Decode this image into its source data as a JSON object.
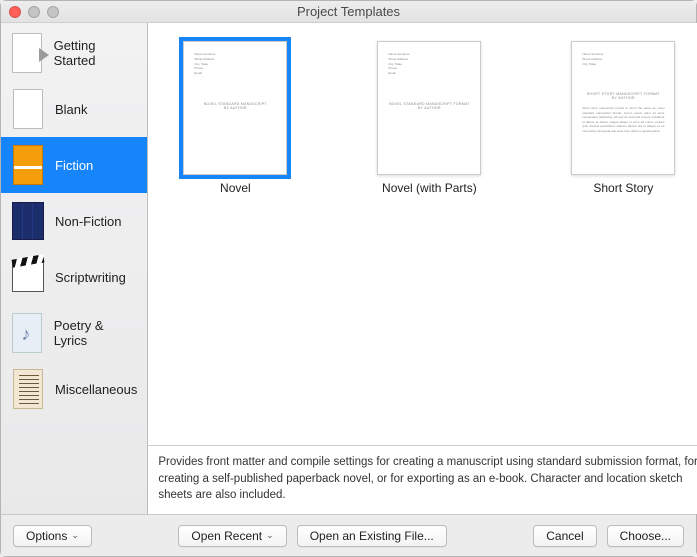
{
  "window": {
    "title": "Project Templates"
  },
  "sidebar": {
    "items": [
      {
        "label": "Getting Started"
      },
      {
        "label": "Blank"
      },
      {
        "label": "Fiction"
      },
      {
        "label": "Non-Fiction"
      },
      {
        "label": "Scriptwriting"
      },
      {
        "label": "Poetry & Lyrics"
      },
      {
        "label": "Miscellaneous"
      }
    ],
    "selected_index": 2
  },
  "templates": {
    "items": [
      {
        "label": "Novel",
        "selected": true
      },
      {
        "label": "Novel (with Parts)",
        "selected": false
      },
      {
        "label": "Short Story",
        "selected": false
      }
    ]
  },
  "description": "Provides front matter and compile settings for creating a manuscript using standard submission format, for creating a self-published paperback novel, or for exporting as an e-book. Character and location sketch sheets are also included.",
  "footer": {
    "options": "Options",
    "open_recent": "Open Recent",
    "open_existing": "Open an Existing File...",
    "cancel": "Cancel",
    "choose": "Choose..."
  }
}
